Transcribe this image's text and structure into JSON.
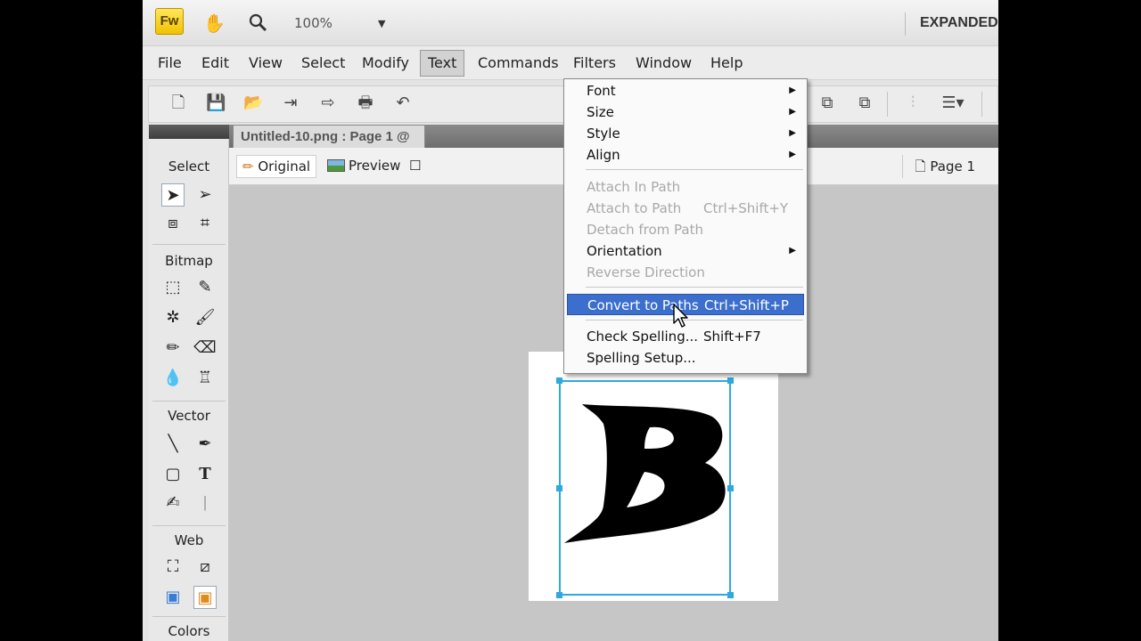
{
  "titlebar": {
    "logo": "Fw",
    "hand_icon": "hand-icon",
    "zoom_icon": "magnifier-icon",
    "zoom_level": "100%",
    "workspace": "EXPANDED"
  },
  "menubar": {
    "items": [
      "File",
      "Edit",
      "View",
      "Select",
      "Modify",
      "Text",
      "Commands",
      "Filters",
      "Window",
      "Help"
    ],
    "active": "Text"
  },
  "document": {
    "tab_title": "Untitled-10.png : Page 1 @",
    "views": [
      "Original",
      "Preview"
    ],
    "active_view": "Original",
    "page": "Page 1"
  },
  "tools": {
    "sections": [
      "Select",
      "Bitmap",
      "Vector",
      "Web",
      "Colors"
    ]
  },
  "text_menu": {
    "items": [
      {
        "label": "Font",
        "submenu": true
      },
      {
        "label": "Size",
        "submenu": true
      },
      {
        "label": "Style",
        "submenu": true
      },
      {
        "label": "Align",
        "submenu": true
      },
      {
        "label": "Attach In Path",
        "disabled": true
      },
      {
        "label": "Attach to Path",
        "shortcut": "Ctrl+Shift+Y",
        "disabled": true
      },
      {
        "label": "Detach from Path",
        "disabled": true
      },
      {
        "label": "Orientation",
        "submenu": true
      },
      {
        "label": "Reverse Direction",
        "disabled": true
      },
      {
        "label": "Convert to Paths",
        "shortcut": "Ctrl+Shift+P",
        "highlighted": true
      },
      {
        "label": "Check Spelling...",
        "shortcut": "Shift+F7"
      },
      {
        "label": "Spelling Setup..."
      }
    ]
  },
  "colors": {
    "highlight": "#3c6fcd",
    "selection": "#2fa8e0",
    "logo": "#f2c200"
  }
}
